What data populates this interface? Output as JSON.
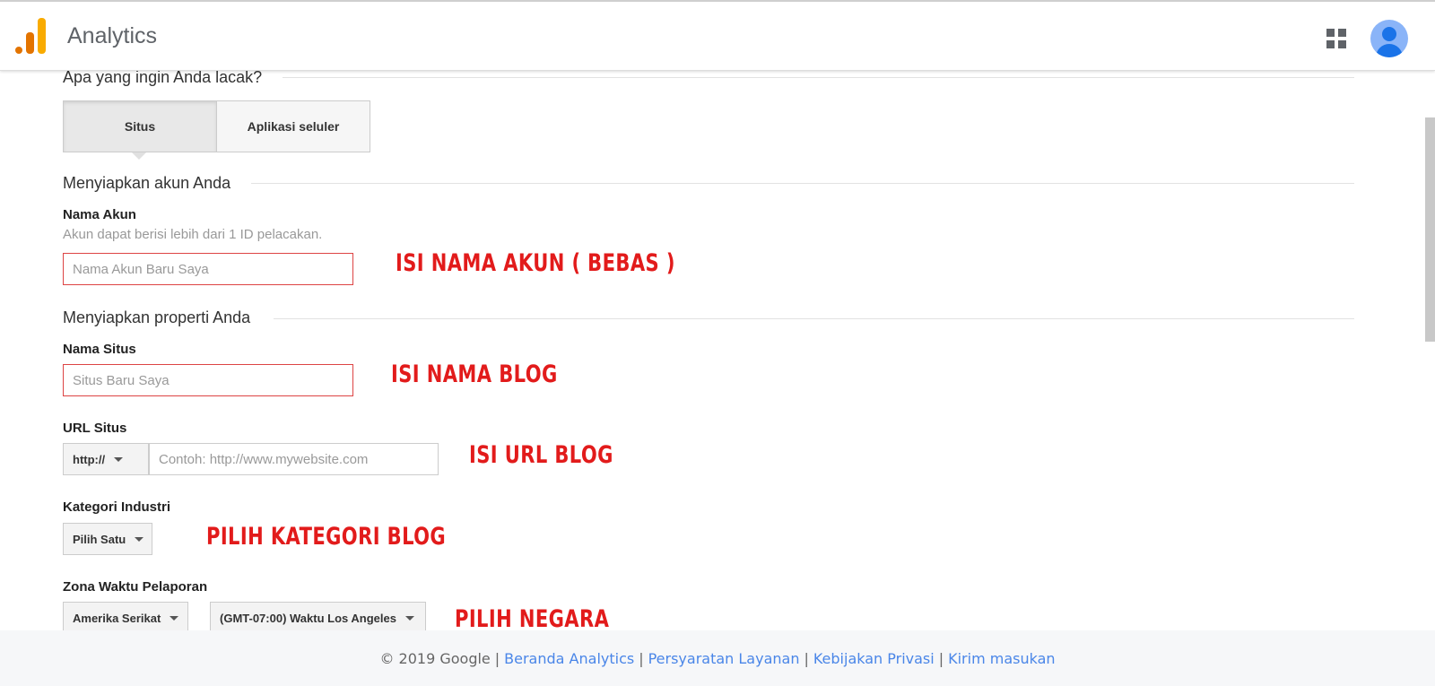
{
  "app": {
    "title": "Analytics"
  },
  "track": {
    "heading": "Apa yang ingin Anda lacak?",
    "options": [
      "Situs",
      "Aplikasi seluler"
    ],
    "selected": "Situs"
  },
  "account_section": {
    "heading": "Menyiapkan akun Anda",
    "label": "Nama Akun",
    "hint": "Akun dapat berisi lebih dari 1 ID pelacakan.",
    "placeholder": "Nama Akun Baru Saya",
    "value": ""
  },
  "property_section": {
    "heading": "Menyiapkan properti Anda",
    "site_name": {
      "label": "Nama Situs",
      "placeholder": "Situs Baru Saya",
      "value": ""
    },
    "site_url": {
      "label": "URL Situs",
      "protocol": "http://",
      "placeholder": "Contoh: http://www.mywebsite.com",
      "value": ""
    },
    "industry": {
      "label": "Kategori Industri",
      "selected": "Pilih Satu"
    },
    "timezone": {
      "label": "Zona Waktu Pelaporan",
      "country": "Amerika Serikat",
      "zone": "(GMT-07:00) Waktu Los Angeles"
    }
  },
  "annotations": {
    "account": "ISI NAMA AKUN ( BEBAS )",
    "site_name": "ISI NAMA BLOG",
    "site_url": "ISI URL BLOG",
    "category": "PILIH KATEGORI BLOG",
    "country": "PILIH NEGARA"
  },
  "footer": {
    "copyright": "© 2019 Google",
    "links": [
      "Beranda Analytics",
      "Persyaratan Layanan",
      "Kebijakan Privasi",
      "Kirim masukan"
    ]
  },
  "colors": {
    "annotation": "#e21b1b",
    "link": "#4a86e8",
    "error_border": "#dd4444",
    "analytics_orange": "#e37400",
    "analytics_yellow": "#f9ab00"
  },
  "icons": {
    "apps": "apps-grid-icon",
    "account": "account-avatar-icon",
    "logo": "analytics-logo-icon"
  }
}
